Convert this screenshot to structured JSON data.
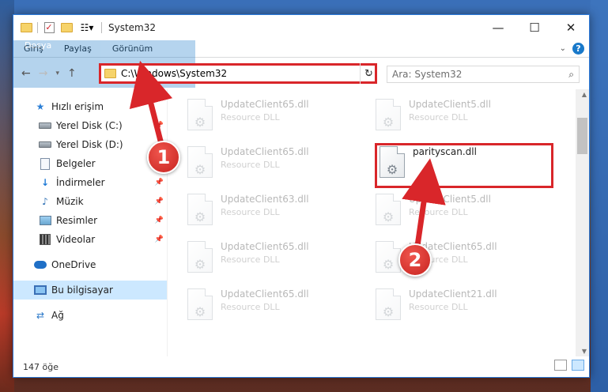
{
  "window": {
    "title": "System32",
    "controls": {
      "minimize": "—",
      "maximize": "☐",
      "close": "✕"
    }
  },
  "ribbon": {
    "tabs": [
      "Dosya",
      "Giriş",
      "Paylaş",
      "Görünüm"
    ],
    "help": "?"
  },
  "address": {
    "path": "C:\\Windows\\System32",
    "search_placeholder": "Ara: System32"
  },
  "sidebar": {
    "quick_access": "Hızlı erişim",
    "items": [
      {
        "label": "Yerel Disk (C:)",
        "icon": "drive-icon",
        "pinned": true
      },
      {
        "label": "Yerel Disk (D:)",
        "icon": "drive-icon",
        "pinned": true
      },
      {
        "label": "Belgeler",
        "icon": "documents-icon",
        "pinned": true
      },
      {
        "label": "İndirmeler",
        "icon": "downloads-icon",
        "pinned": true
      },
      {
        "label": "Müzik",
        "icon": "music-icon",
        "pinned": true
      },
      {
        "label": "Resimler",
        "icon": "pictures-icon",
        "pinned": true
      },
      {
        "label": "Videolar",
        "icon": "videos-icon",
        "pinned": true
      }
    ],
    "onedrive": "OneDrive",
    "this_pc": "Bu bilgisayar",
    "network": "Ağ"
  },
  "files": [
    {
      "name": "UpdateClient65.dll",
      "desc": "Resource DLL"
    },
    {
      "name": "UpdateClient5.dll",
      "desc": "Resource DLL"
    },
    {
      "name": "UpdateClient65.dll",
      "desc": "Resource DLL"
    },
    {
      "name": "parityscan.dll",
      "desc": ""
    },
    {
      "name": "UpdateClient63.dll",
      "desc": "Resource DLL"
    },
    {
      "name": "UpdateClient5.dll",
      "desc": "Resource DLL"
    },
    {
      "name": "UpdateClient65.dll",
      "desc": "Resource DLL"
    },
    {
      "name": "UpdateClient65.dll",
      "desc": "Resource DLL"
    },
    {
      "name": "UpdateClient65.dll",
      "desc": "Resource DLL"
    },
    {
      "name": "UpdateClient21.dll",
      "desc": "Resource DLL"
    }
  ],
  "status": {
    "count": "147 öğe"
  },
  "annotations": {
    "step1": "1",
    "step2": "2",
    "color": "#d9262a"
  }
}
